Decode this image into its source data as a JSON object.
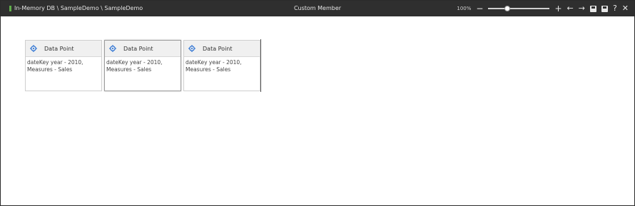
{
  "titlebar": {
    "breadcrumb": "In-Memory DB \\ SampleDemo \\ SampleDemo",
    "title": "Custom Member",
    "zoom_label": "100%",
    "zoom_value_percent": 30,
    "icons": {
      "zoom_out": "−",
      "zoom_in": "+",
      "back": "←",
      "forward": "→",
      "help": "?",
      "close": "✕"
    }
  },
  "cards": [
    {
      "header": "Data Point",
      "line1": "dateKey year - 2010,",
      "line2": "Measures - Sales"
    },
    {
      "header": "Data Point",
      "line1": "dateKey year - 2010,",
      "line2": "Measures - Sales"
    },
    {
      "header": "Data Point",
      "line1": "dateKey year - 2010,",
      "line2": "Measures - Sales"
    }
  ],
  "colors": {
    "titlebar_bg": "#2f2f2f",
    "gear_blue": "#3a7bd5",
    "card_header_bg": "#f0f0f0"
  }
}
